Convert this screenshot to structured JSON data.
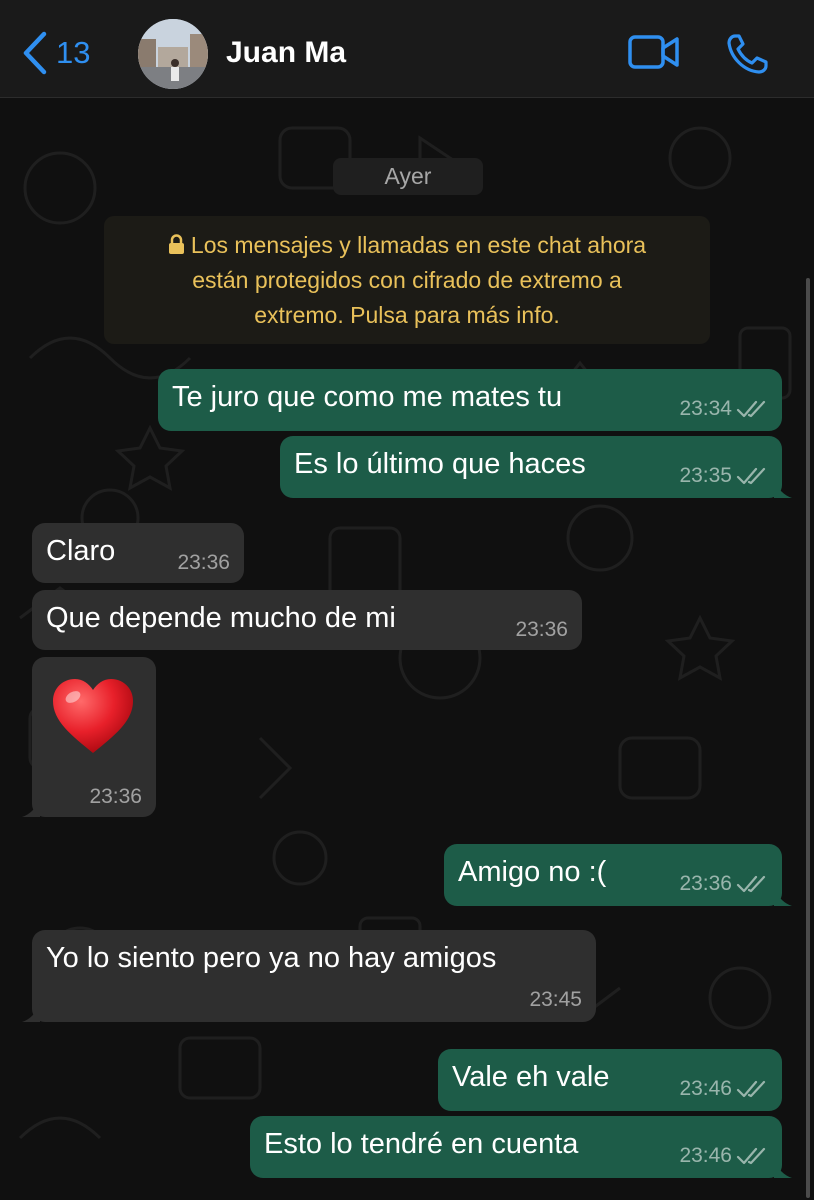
{
  "header": {
    "back_count": "13",
    "contact_name": "Juan Ma"
  },
  "chat": {
    "date_label": "Ayer",
    "notice_lines": [
      "Los mensajes y llamadas en este chat ahora",
      "están protegidos con cifrado de extremo a",
      "extremo. Pulsa para más info."
    ],
    "messages": [
      {
        "dir": "out",
        "text": "Te juro que como me mates tu",
        "time": "23:34",
        "read": true
      },
      {
        "dir": "out",
        "text": "Es lo último que haces",
        "time": "23:35",
        "read": true
      },
      {
        "dir": "in",
        "text": "Claro",
        "time": "23:36"
      },
      {
        "dir": "in",
        "text": "Que depende mucho de mi",
        "time": "23:36"
      },
      {
        "dir": "in",
        "emoji": "red-heart",
        "time": "23:36"
      },
      {
        "dir": "out",
        "text": "Amigo no :(",
        "time": "23:36",
        "read": true
      },
      {
        "dir": "in",
        "text": "Yo lo siento pero ya no hay amigos",
        "time": "23:45"
      },
      {
        "dir": "out",
        "text": "Vale eh vale",
        "time": "23:46",
        "read": true
      },
      {
        "dir": "out",
        "text": "Esto lo tendré en cuenta",
        "time": "23:46",
        "read": true
      }
    ]
  },
  "colors": {
    "accent": "#2f8ff0",
    "outgoing_bubble": "#1d5c48",
    "incoming_bubble": "#2f2f2f",
    "notice_text": "#e9c15a"
  }
}
